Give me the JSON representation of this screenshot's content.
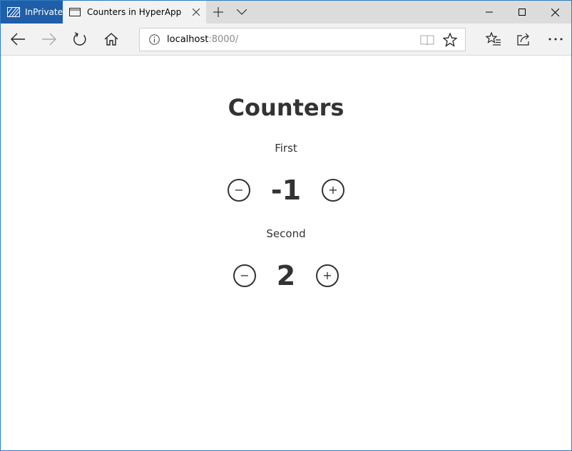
{
  "browser": {
    "inprivate_label": "InPrivate",
    "tab_title": "Counters in HyperApp",
    "url_host": "localhost",
    "url_rest": ":8000/"
  },
  "page": {
    "title": "Counters",
    "counters": [
      {
        "label": "First",
        "value": "-1",
        "decrement": "−",
        "increment": "+"
      },
      {
        "label": "Second",
        "value": "2",
        "decrement": "−",
        "increment": "+"
      }
    ]
  },
  "colors": {
    "inprivate_bg": "#1f5ea8",
    "text": "#333333",
    "window_border": "#2f7bbf"
  },
  "icons": {
    "inprivate": "inprivate-icon",
    "tab": "tab-page-icon",
    "close_tab": "close-icon",
    "new_tab": "plus-icon",
    "tab_menu": "chevron-down-icon",
    "minimize": "minimize-icon",
    "maximize": "maximize-icon",
    "close_window": "close-icon",
    "back": "back-arrow-icon",
    "forward": "forward-arrow-icon",
    "refresh": "refresh-icon",
    "home": "home-icon",
    "info": "info-icon",
    "reading_view": "reading-view-icon",
    "favorite": "star-icon",
    "favorites_hub": "favorites-hub-icon",
    "share": "share-icon",
    "more": "more-icon"
  }
}
